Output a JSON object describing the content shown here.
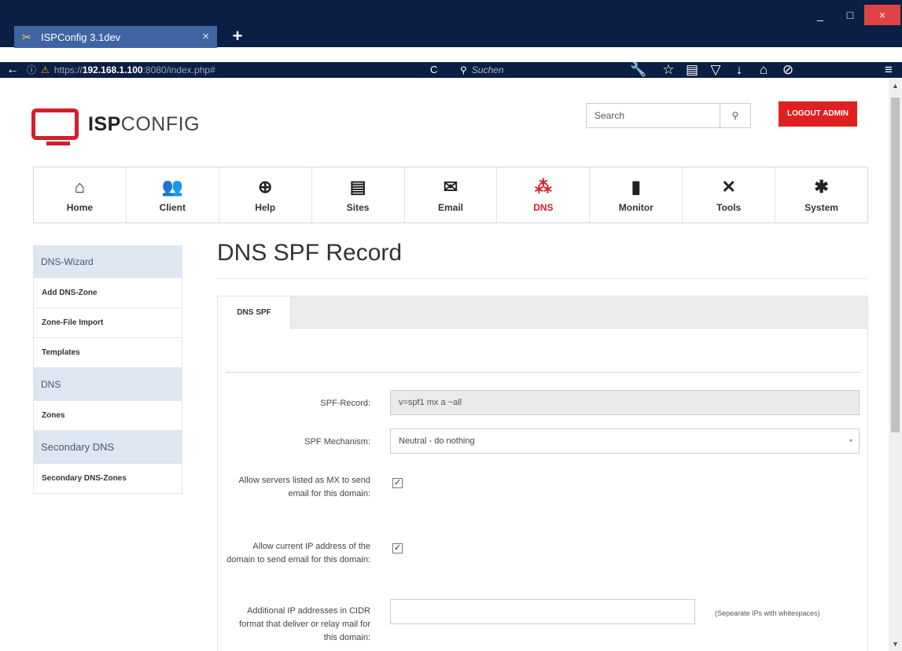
{
  "browser": {
    "tab_title": "ISPConfig 3.1dev",
    "tab_close": "×",
    "new_tab": "+",
    "url_prefix": "https://",
    "url_host": "192.168.1.100",
    "url_rest": ":8080/index.php#",
    "search_placeholder": "Suchen",
    "win_min": "_",
    "win_max": "□",
    "win_close": "×"
  },
  "header": {
    "logo_bold": "ISP",
    "logo_rest": "CONFIG",
    "search_placeholder": "Search",
    "search_btn": "🔍",
    "logout": "LOGOUT ADMIN"
  },
  "nav": [
    {
      "label": "Home",
      "icon": "⌂"
    },
    {
      "label": "Client",
      "icon": "👥"
    },
    {
      "label": "Help",
      "icon": "⊕"
    },
    {
      "label": "Sites",
      "icon": "▤"
    },
    {
      "label": "Email",
      "icon": "✉"
    },
    {
      "label": "DNS",
      "icon": "⁂"
    },
    {
      "label": "Monitor",
      "icon": "▮"
    },
    {
      "label": "Tools",
      "icon": "✕"
    },
    {
      "label": "System",
      "icon": "✱"
    }
  ],
  "sidebar": {
    "section1": "DNS-Wizard",
    "items1": [
      "Add DNS-Zone",
      "Zone-File Import",
      "Templates"
    ],
    "section2": "DNS",
    "items2": [
      "Zones"
    ],
    "section3": "Secondary DNS",
    "items3": [
      "Secondary DNS-Zones"
    ]
  },
  "content": {
    "title": "DNS SPF Record",
    "tab": "DNS SPF",
    "fields": {
      "spf_record_label": "SPF-Record:",
      "spf_record_value": "v=spf1 mx a ~all",
      "mechanism_label": "SPF Mechanism:",
      "mechanism_value": "Neutral - do nothing",
      "allow_mx_label": "Allow servers listed as MX to send email for this domain:",
      "allow_mx_checked": true,
      "allow_ip_label": "Allow current IP address of the domain to send email for this domain:",
      "allow_ip_checked": true,
      "additional_ip_label": "Additional IP addresses in CIDR format that deliver or relay mail for this domain:",
      "additional_ip_value": "",
      "additional_ip_hint": "(Sepearate IPs with whitespaces)"
    }
  },
  "colors": {
    "accent": "#d31f2a",
    "chrome": "#0b1f44",
    "tab": "#3f64a4"
  }
}
